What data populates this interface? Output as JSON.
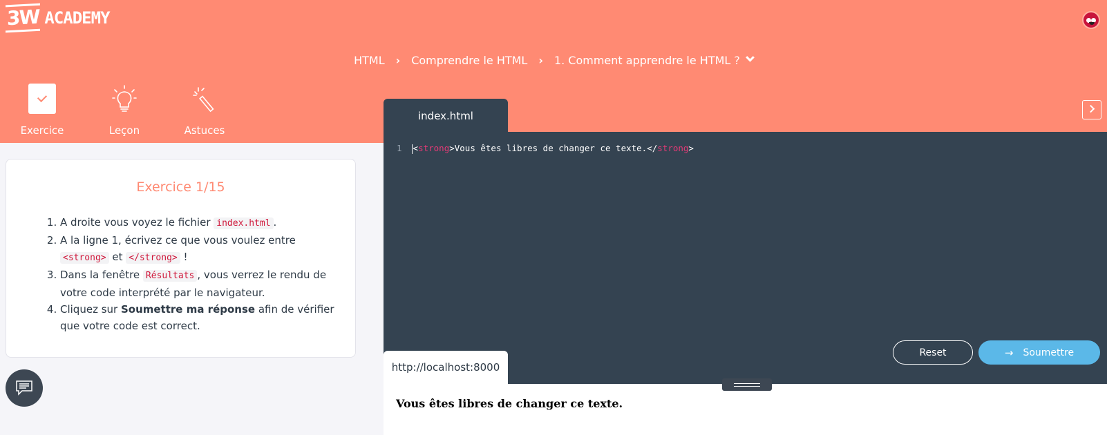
{
  "brand": {
    "mark": "3W",
    "name": "ACADEMY"
  },
  "breadcrumb": {
    "items": [
      "HTML",
      "Comprendre le HTML",
      "1. Comment apprendre le HTML ?"
    ],
    "separator": "›"
  },
  "tabs": [
    {
      "label": "Exercice",
      "icon": "book-check-icon",
      "active": true
    },
    {
      "label": "Leçon",
      "icon": "lightbulb-icon",
      "active": false
    },
    {
      "label": "Astuces",
      "icon": "magic-wand-icon",
      "active": false
    }
  ],
  "exercise": {
    "title": "Exercice 1/15",
    "steps": [
      {
        "pre": "A droite vous voyez le fichier ",
        "code": "index.html",
        "post": "."
      },
      {
        "pre": "A la ligne 1, écrivez ce que vous voulez entre ",
        "code1": "<strong>",
        "mid": " et ",
        "code2": "</strong>",
        "post": " !"
      },
      {
        "pre": "Dans la fenêtre ",
        "code": "Résultats",
        "post": ", vous verrez le rendu de votre code interprété par le navigateur."
      },
      {
        "pre": "Cliquez sur ",
        "bold": "Soumettre ma réponse",
        "post": " afin de vérifier que votre code est correct."
      }
    ]
  },
  "editor": {
    "file_tab": "index.html",
    "line_number": "1",
    "code": {
      "open_lt": "<",
      "open_tag": "strong",
      "open_gt": ">",
      "text": "Vous êtes libres de changer ce texte.",
      "close_lt": "</",
      "close_tag": "strong",
      "close_gt": ">"
    },
    "reset_label": "Reset",
    "submit_label": "Soumettre"
  },
  "preview": {
    "url": "http://localhost:8000",
    "output": "Vous êtes libres de changer ce texte."
  },
  "colors": {
    "brand": "#ff8a73",
    "editor_bg": "#344351",
    "submit": "#5bb8e8",
    "code_tag": "#e63a77"
  }
}
